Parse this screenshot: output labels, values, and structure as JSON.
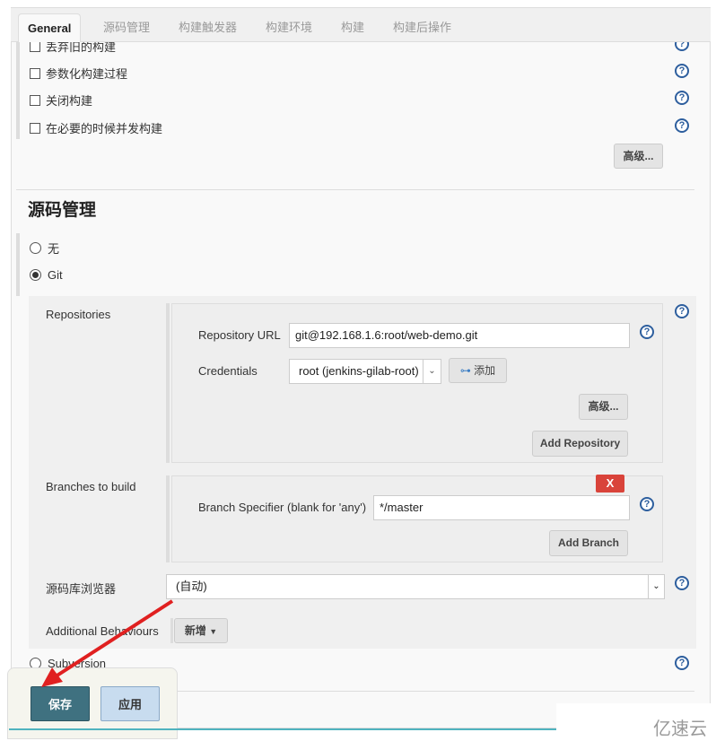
{
  "tabs": [
    "General",
    "源码管理",
    "构建触发器",
    "构建环境",
    "构建",
    "构建后操作"
  ],
  "general": {
    "options": [
      "丢弃旧的构建",
      "参数化构建过程",
      "关闭构建",
      "在必要的时候并发构建"
    ],
    "advanced_label": "高级..."
  },
  "scm": {
    "title": "源码管理",
    "options": [
      {
        "label": "无",
        "selected": false
      },
      {
        "label": "Git",
        "selected": true
      },
      {
        "label": "Subversion",
        "selected": false
      }
    ],
    "repositories_label": "Repositories",
    "repo_url_label": "Repository URL",
    "repo_url": "git@192.168.1.6:root/web-demo.git",
    "credentials_label": "Credentials",
    "credentials_value": "root (jenkins-gilab-root)",
    "add_credentials_label": "添加",
    "repo_advanced_label": "高级...",
    "add_repository_label": "Add Repository",
    "branches_label": "Branches to build",
    "delete_branch_label": "X",
    "branch_specifier_label": "Branch Specifier (blank for 'any')",
    "branch_specifier": "*/master",
    "add_branch_label": "Add Branch",
    "browser_label": "源码库浏览器",
    "browser_value": "(自动)",
    "additional_label": "Additional Behaviours",
    "add_behaviour_label": "新增"
  },
  "footer": {
    "save_label": "保存",
    "apply_label": "应用"
  },
  "watermark": "亿速云",
  "colors": {
    "save": "#3f7180",
    "apply": "#c8dcef",
    "delete": "#d9433a",
    "arrow": "#e02020",
    "help": "#2e5f9e"
  }
}
